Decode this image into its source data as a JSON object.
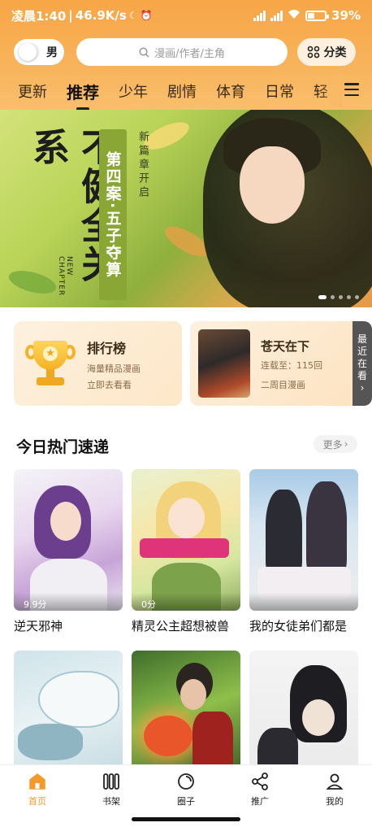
{
  "status_bar": {
    "time": "凌晨1:40",
    "speed": "46.9K/s",
    "battery_percent": "39%",
    "battery_level": 0.39
  },
  "search": {
    "gender_label": "男",
    "placeholder": "漫画/作者/主角",
    "category_label": "分类"
  },
  "tabs": [
    {
      "label": "更新",
      "active": false
    },
    {
      "label": "推荐",
      "active": true
    },
    {
      "label": "少年",
      "active": false
    },
    {
      "label": "剧情",
      "active": false
    },
    {
      "label": "体育",
      "active": false
    },
    {
      "label": "日常",
      "active": false
    },
    {
      "label": "轻",
      "active": false
    }
  ],
  "banner": {
    "title": "不健全关系",
    "ribbon": "第四案·五子夺算",
    "subtitle": "新篇章开启",
    "english": "NEW CHAPTER",
    "slide_count": 5,
    "active_slide": 0
  },
  "rank_card": {
    "title": "排行榜",
    "line1": "海量精品漫画",
    "line2": "立即去看看"
  },
  "recent_card": {
    "title": "苍天在下",
    "progress": "连载至：115回",
    "tag": "二周目漫画",
    "side_label": [
      "最",
      "近",
      "在",
      "看"
    ]
  },
  "section": {
    "title": "今日热门速递",
    "more": "更多"
  },
  "comics": [
    {
      "name": "逆天邪神",
      "score": "9.9分"
    },
    {
      "name": "精灵公主超想被兽",
      "score": "0分"
    },
    {
      "name": "我的女徒弟们都是",
      "score": ""
    },
    {
      "name": "",
      "score": ""
    },
    {
      "name": "",
      "score": ""
    },
    {
      "name": "",
      "score": ""
    }
  ],
  "nav": [
    {
      "label": "首页",
      "icon": "home-icon",
      "active": true
    },
    {
      "label": "书架",
      "icon": "bookshelf-icon",
      "active": false
    },
    {
      "label": "圈子",
      "icon": "circle-icon",
      "active": false
    },
    {
      "label": "推广",
      "icon": "share-icon",
      "active": false
    },
    {
      "label": "我的",
      "icon": "user-icon",
      "active": false
    }
  ],
  "colors": {
    "accent": "#f39a2a",
    "header_top": "#f7a647",
    "header_bottom": "#f9bf6d"
  }
}
